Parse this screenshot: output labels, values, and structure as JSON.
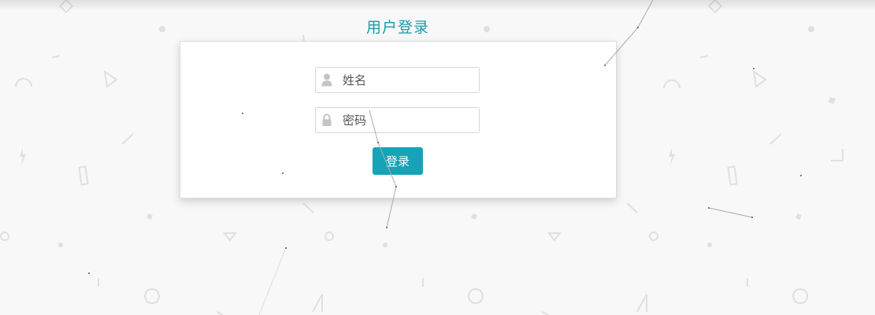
{
  "header": {
    "title": "用户登录"
  },
  "form": {
    "username_placeholder": "姓名",
    "password_placeholder": "密码",
    "submit_label": "登录"
  },
  "icons": {
    "username": "user-icon",
    "password": "lock-icon"
  },
  "colors": {
    "accent": "#17a2b8",
    "title": "#1b9aaa",
    "background": "#f8f8f8"
  }
}
